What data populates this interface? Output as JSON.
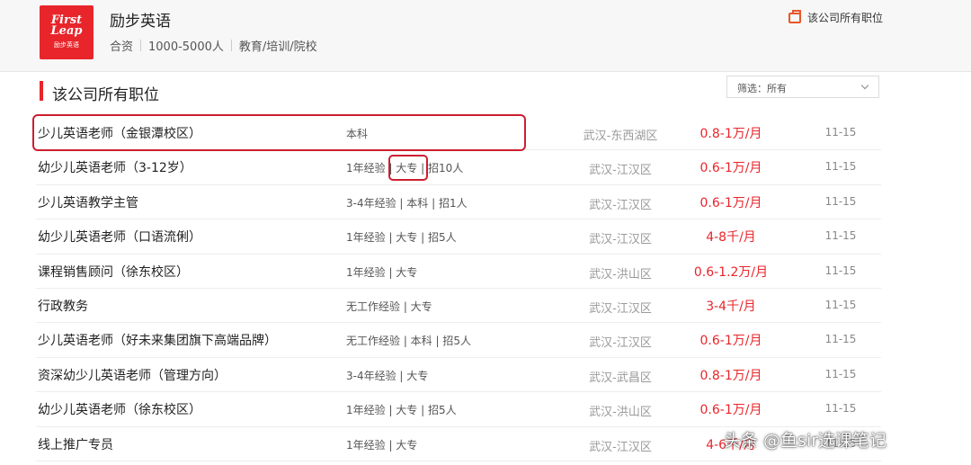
{
  "company": {
    "logo_text": "First Leap",
    "logo_subtitle": "励步英语",
    "name": "励步英语",
    "meta": [
      "合资",
      "1000-5000人",
      "教育/培训/院校"
    ],
    "all_jobs_link": "该公司所有职位"
  },
  "section": {
    "title": "该公司所有职位",
    "filter_label": "筛选：所有"
  },
  "jobs": [
    {
      "title": "少儿英语老师（金银潭校区）",
      "requirements": "本科",
      "location": "武汉-东西湖区",
      "salary": "0.8-1万/月",
      "date": "11-15"
    },
    {
      "title": "幼少儿英语老师（3-12岁）",
      "requirements": "1年经验 | 大专 | 招10人",
      "location": "武汉-江汉区",
      "salary": "0.6-1万/月",
      "date": "11-15"
    },
    {
      "title": "少儿英语教学主管",
      "requirements": "3-4年经验 | 本科 | 招1人",
      "location": "武汉-江汉区",
      "salary": "0.6-1万/月",
      "date": "11-15"
    },
    {
      "title": "幼少儿英语老师（口语流俐）",
      "requirements": "1年经验 | 大专 | 招5人",
      "location": "武汉-江汉区",
      "salary": "4-8千/月",
      "date": "11-15"
    },
    {
      "title": "课程销售顾问（徐东校区）",
      "requirements": "1年经验 | 大专",
      "location": "武汉-洪山区",
      "salary": "0.6-1.2万/月",
      "date": "11-15"
    },
    {
      "title": "行政教务",
      "requirements": "无工作经验 | 大专",
      "location": "武汉-江汉区",
      "salary": "3-4千/月",
      "date": "11-15"
    },
    {
      "title": "少儿英语老师（好未来集团旗下高端品牌）",
      "requirements": "无工作经验 | 本科 | 招5人",
      "location": "武汉-江汉区",
      "salary": "0.6-1万/月",
      "date": "11-15"
    },
    {
      "title": "资深幼少儿英语老师（管理方向）",
      "requirements": "3-4年经验 | 大专",
      "location": "武汉-武昌区",
      "salary": "0.8-1万/月",
      "date": "11-15"
    },
    {
      "title": "幼少儿英语老师（徐东校区）",
      "requirements": "1年经验 | 大专 | 招5人",
      "location": "武汉-洪山区",
      "salary": "0.6-1万/月",
      "date": "11-15"
    },
    {
      "title": "线上推广专员",
      "requirements": "1年经验 | 大专",
      "location": "武汉-江汉区",
      "salary": "4-6千/月",
      "date": "11-15"
    }
  ],
  "watermark": "头条 @鱼sir选课笔记",
  "colors": {
    "brand": "#e8252b",
    "salary": "#e8252b",
    "annotation": "#cc1f2f"
  }
}
